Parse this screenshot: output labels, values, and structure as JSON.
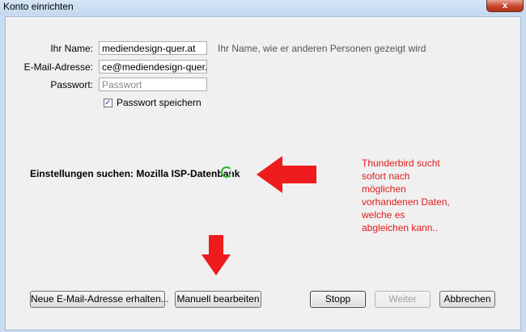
{
  "window": {
    "title": "Konto einrichten",
    "close_glyph": "x"
  },
  "form": {
    "name_label": "Ihr Name:",
    "name_value": "mediendesign-quer.at",
    "name_hint": "Ihr Name, wie er anderen Personen gezeigt wird",
    "email_label": "E-Mail-Adresse:",
    "email_value": "ce@mediendesign-quer.at",
    "password_label": "Passwort:",
    "password_placeholder": "Passwort",
    "save_password_label": "Passwort speichern",
    "save_password_checked": true
  },
  "status": {
    "text": "Einstellungen suchen: Mozilla ISP-Datenbank",
    "spinner_color": "#2fb52f"
  },
  "annotation": {
    "text": "Thunderbird sucht\nsofort nach\nmöglichen\nvorhandenen Daten,\nwelche es\nabgleichen kann..",
    "color": "#e21b1b"
  },
  "buttons": {
    "new_address": "Neue E-Mail-Adresse erhalten...",
    "manual_edit": "Manuell bearbeiten",
    "stop": "Stopp",
    "continue": "Weiter",
    "cancel": "Abbrechen"
  }
}
